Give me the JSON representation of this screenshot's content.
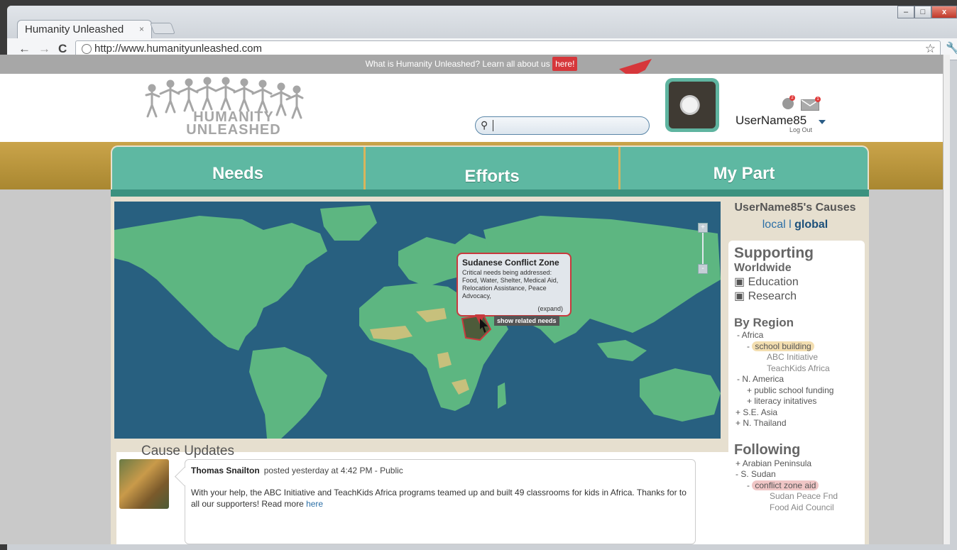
{
  "browser": {
    "tab_title": "Humanity Unleashed",
    "tab_close": "×",
    "url": "http://www.humanityunleashed.com",
    "window_buttons": {
      "minimize": "–",
      "maximize": "□",
      "close": "x"
    }
  },
  "promo": {
    "text": "What is Humanity Unleashed? Learn all about us ",
    "link": "here!"
  },
  "logo": {
    "line1": "HUMANITY",
    "line2": "UNLEASHED"
  },
  "header": {
    "username": "UserName85",
    "logout": "Log Out",
    "notif_count_globe": "2",
    "notif_count_mail": "1"
  },
  "nav": {
    "tabs": [
      "Needs",
      "Efforts",
      "My Part"
    ]
  },
  "map": {
    "popup_title": "Sudanese Conflict Zone",
    "popup_body": "Critical needs being addressed: Food, Water, Shelter, Medical Aid, Relocation Assistance, Peace Advocacy,",
    "popup_expand": "(expand)",
    "show_related": "show related needs",
    "zoom_in": "+",
    "zoom_out": "-"
  },
  "updates": {
    "title": "Cause Updates",
    "author": "Thomas Snailton",
    "meta": "posted yesterday at 4:42 PM - Public",
    "body": "With your help, the ABC Initiative and TeachKids Africa programs teamed up and built 49 classrooms for kids in Africa. Thanks for to all our supporters! Read more ",
    "read_more": "here"
  },
  "sidebar": {
    "title": "UserName85's Causes",
    "local": "local",
    "separator": "l",
    "global": "global",
    "supporting": "Supporting",
    "worldwide": "Worldwide",
    "worldwide_items": [
      "Education",
      "Research"
    ],
    "by_region": "By Region",
    "africa": "Africa",
    "school_building": "school building",
    "africa_orgs": [
      "ABC Initiative",
      "TeachKids Africa"
    ],
    "n_america": "N. America",
    "na_items": [
      "public school funding",
      "literacy initatives"
    ],
    "se_asia": "S.E. Asia",
    "n_thailand": "N. Thailand",
    "following": "Following",
    "arabian": "Arabian Peninsula",
    "s_sudan": "S. Sudan",
    "conflict_aid": "conflict zone aid",
    "sudan_orgs": [
      "Sudan Peace Fnd",
      "Food Aid Council"
    ]
  },
  "colors": {
    "teal": "#5eb8a2",
    "gold": "#caa44a",
    "red": "#d6373b",
    "ocean": "#286080",
    "land": "#5db681"
  },
  "icons": [
    "back-arrow-icon",
    "forward-arrow-icon",
    "reload-icon",
    "globe-icon",
    "star-icon",
    "wrench-icon",
    "search-icon",
    "mail-icon",
    "caret-down-icon"
  ]
}
